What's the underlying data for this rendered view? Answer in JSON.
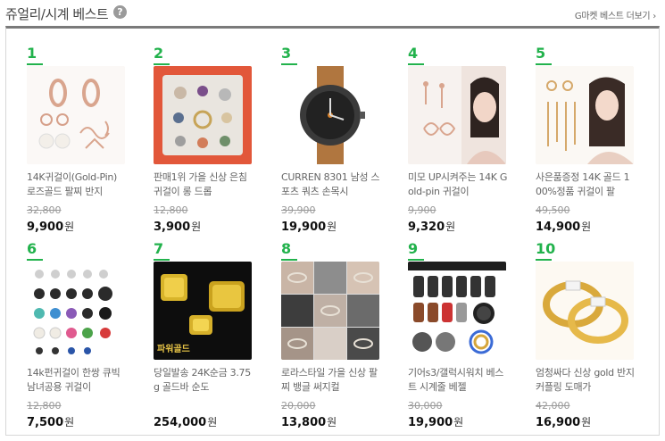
{
  "header": {
    "title": "쥬얼리/시계 베스트",
    "help_icon": "?",
    "more_label": "G마켓 베스트 더보기",
    "more_chevron": "›"
  },
  "colors": {
    "rank": "#22b24c",
    "border_top": "#7a7a7a"
  },
  "currency": "원",
  "products": [
    {
      "rank": "1",
      "name": "14K귀걸이(Gold-Pin) 로즈골드 팔찌 반지",
      "original_price": "32,800",
      "price": "9,900",
      "thumb_icon": "rose-gold-earrings-image"
    },
    {
      "rank": "2",
      "name": "판매1위 가을 신상 은침귀걸이 롱 드롭",
      "original_price": "12,800",
      "price": "3,900",
      "thumb_icon": "earring-set-image"
    },
    {
      "rank": "3",
      "name": "CURREN 8301 남성 스포츠 쿼츠 손목시",
      "original_price": "39,900",
      "price": "19,900",
      "thumb_icon": "wristwatch-image"
    },
    {
      "rank": "4",
      "name": "미모 UP시켜주는 14K Gold-pin 귀걸이",
      "original_price": "9,900",
      "price": "9,320",
      "thumb_icon": "model-earrings-image"
    },
    {
      "rank": "5",
      "name": "사은품증정 14K 골드 100%정품 귀걸이 팔",
      "original_price": "49,500",
      "price": "14,900",
      "thumb_icon": "gold-earrings-model-image"
    },
    {
      "rank": "6",
      "name": "14k펀귀걸이 한쌍 큐빅 남녀공용 귀걸이",
      "original_price": "12,800",
      "price": "7,500",
      "thumb_icon": "stud-earrings-grid-image"
    },
    {
      "rank": "7",
      "name": "당일발송 24K순금 3.75g 골드바 순도",
      "original_price": "",
      "price": "254,000",
      "thumb_icon": "gold-bar-image",
      "thumb_text": "파워골드"
    },
    {
      "rank": "8",
      "name": "로라스타일 가을 신상 팔찌 뱅글 써지컬",
      "original_price": "20,000",
      "price": "13,800",
      "thumb_icon": "bracelet-collage-image"
    },
    {
      "rank": "9",
      "name": "기어s3/갤럭시워치 베스트 시계줄 베젤",
      "original_price": "30,000",
      "price": "19,900",
      "thumb_icon": "watch-bands-image"
    },
    {
      "rank": "10",
      "name": "엄청싸다 신상 gold 반지 커플링 도매가",
      "original_price": "42,000",
      "price": "16,900",
      "thumb_icon": "gold-rings-image"
    }
  ]
}
